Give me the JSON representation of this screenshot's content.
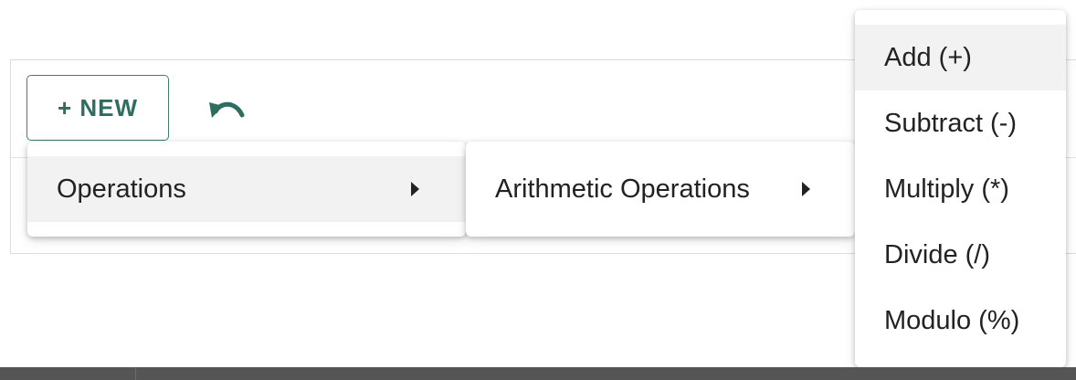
{
  "toolbar": {
    "new_button_label": "+ NEW",
    "undo_icon": "undo-icon"
  },
  "menus": {
    "level1": {
      "items": [
        {
          "label": "Operations",
          "has_submenu": true,
          "highlighted": true
        }
      ]
    },
    "level2": {
      "items": [
        {
          "label": "Arithmetic Operations",
          "has_submenu": true,
          "highlighted": false
        }
      ]
    },
    "level3": {
      "items": [
        {
          "label": "Add (+)",
          "highlighted": true
        },
        {
          "label": "Subtract (-)",
          "highlighted": false
        },
        {
          "label": "Multiply (*)",
          "highlighted": false
        },
        {
          "label": "Divide (/)",
          "highlighted": false
        },
        {
          "label": "Modulo (%)",
          "highlighted": false
        }
      ]
    }
  },
  "colors": {
    "accent": "#2e6e60",
    "menu_highlight": "#f2f2f2",
    "bottom_bar": "#555555"
  }
}
